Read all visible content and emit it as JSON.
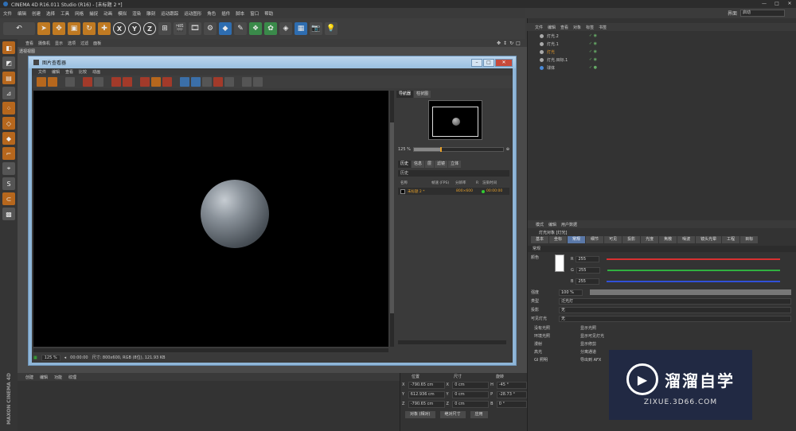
{
  "window": {
    "title": "CINEMA 4D R16.011 Studio (R16) - [未标题 2 *]",
    "minimize": "—",
    "maximize": "□",
    "close": "✕"
  },
  "menubar": [
    "文件",
    "编辑",
    "创建",
    "选择",
    "工具",
    "网格",
    "捕捉",
    "动画",
    "模拟",
    "渲染",
    "雕刻",
    "运动跟踪",
    "运动图形",
    "角色",
    "插件",
    "脚本",
    "窗口",
    "帮助"
  ],
  "layout": {
    "label": "界面",
    "value": "启动"
  },
  "toolbar": {
    "undo": "↶",
    "icons": [
      "pointer-icon",
      "move-icon",
      "scale-icon",
      "rotate-icon",
      "add-icon"
    ],
    "axis": [
      "X",
      "Y",
      "Z"
    ]
  },
  "viewport": {
    "menu": [
      "查看",
      "摄像机",
      "显示",
      "选项",
      "过滤",
      "面板"
    ],
    "label": "透视视图"
  },
  "object_manager": {
    "menu": [
      "文件",
      "编辑",
      "查看",
      "对象",
      "标签",
      "书签"
    ],
    "objects": [
      {
        "name": "灯光.2",
        "selected": false
      },
      {
        "name": "灯光.1",
        "selected": false
      },
      {
        "name": "灯光",
        "selected": true
      },
      {
        "name": "灯光.目标.1",
        "selected": false
      },
      {
        "name": "球体",
        "selected": false
      }
    ]
  },
  "attribute_manager": {
    "menu": [
      "模式",
      "编辑",
      "用户数据"
    ],
    "title": "灯光对象 [灯光]",
    "tabs": [
      "基本",
      "坐标",
      "常规",
      "细节",
      "可见",
      "投影",
      "光度",
      "焦散",
      "噪波",
      "镜头光晕",
      "工程",
      "目标"
    ],
    "active_tab": "常规",
    "section": "常规",
    "color_label": "颜色",
    "rgb": [
      {
        "ch": "R",
        "value": "255",
        "color": "#d83030"
      },
      {
        "ch": "G",
        "value": "255",
        "color": "#30b040"
      },
      {
        "ch": "B",
        "value": "255",
        "color": "#3050d8"
      }
    ],
    "intensity_label": "强度",
    "intensity_value": "100 %",
    "rows": [
      {
        "label": "类型",
        "value": "泛光灯"
      },
      {
        "label": "投影",
        "value": "无"
      },
      {
        "label": "可见灯光",
        "value": "无"
      }
    ],
    "checks_left": [
      "没有光照",
      "环境光照",
      "漫射",
      "高光",
      "GI 照明"
    ],
    "checks_right": [
      "显示光照",
      "显示可见灯光",
      "显示修剪",
      "分离通道",
      "导出到 AFX"
    ]
  },
  "bottom_panel": {
    "menu": [
      "创建",
      "编辑",
      "功能",
      "纹理"
    ]
  },
  "coords": {
    "headers": [
      "位置",
      "尺寸",
      "旋转"
    ],
    "rows": [
      {
        "axis": "X",
        "pos": "-790.65 cm",
        "size": "0 cm",
        "rot_axis": "H",
        "rot": "-45 °"
      },
      {
        "axis": "Y",
        "pos": "612.936 cm",
        "size": "0 cm",
        "rot_axis": "P",
        "rot": "-28.73 °"
      },
      {
        "axis": "Z",
        "pos": "-790.65 cm",
        "size": "0 cm",
        "rot_axis": "B",
        "rot": "0 °"
      }
    ],
    "mode": "对象 (相对)",
    "size_mode": "绝对尺寸",
    "apply": "应用"
  },
  "maxon": "MAXON CINEMA 4D",
  "picture_viewer": {
    "title": "图片查看器",
    "menu": [
      "文件",
      "编辑",
      "查看",
      "比较",
      "动画"
    ],
    "nav_tabs": [
      "导航器",
      "柱状图"
    ],
    "zoom": "125 %",
    "history_tabs": [
      "历史",
      "信息",
      "层",
      "滤镜",
      "立体"
    ],
    "history_section": "历史",
    "history_headers": [
      "名称",
      "帧速 (FPS)",
      "分辨率",
      "R",
      "渲染时间"
    ],
    "history_row": {
      "name": "未标题 2 *",
      "res": "800×600",
      "time": "00:00:00"
    },
    "status_zoom": "125 %",
    "status_time": "00:00:00",
    "status_info": "尺寸: 800x600, RGB (8位), 121.93 KB"
  },
  "watermark": {
    "cn": "溜溜自学",
    "url": "ZIXUE.3D66.COM"
  }
}
